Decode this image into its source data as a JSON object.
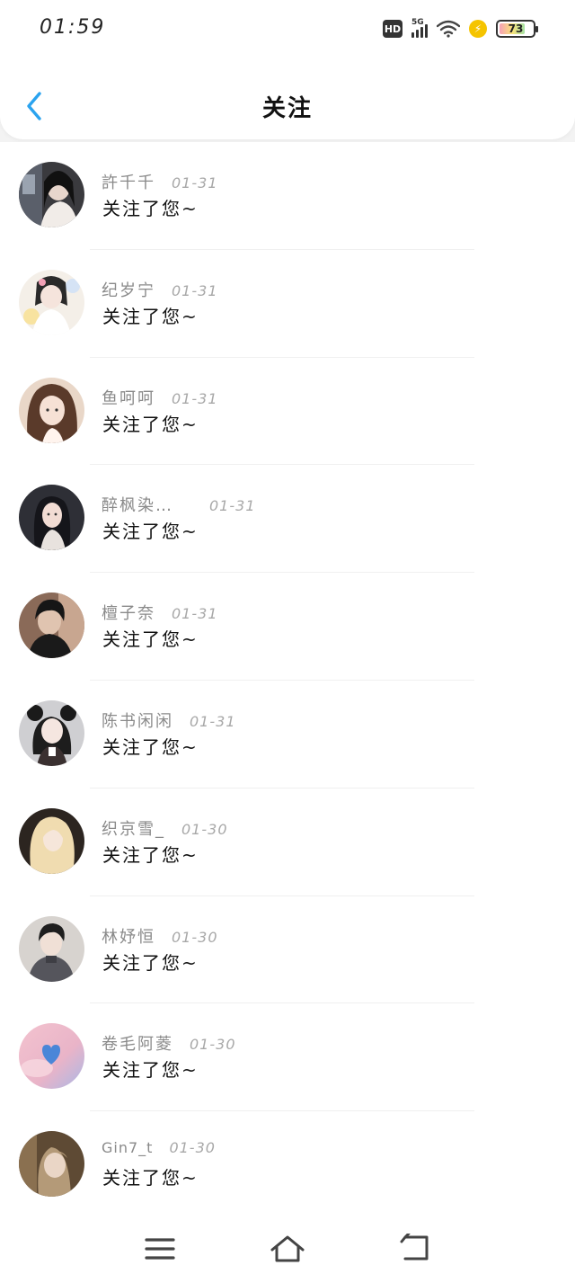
{
  "status_bar": {
    "time": "01:59",
    "hd": "HD",
    "network": "5G",
    "battery": "73"
  },
  "header": {
    "title": "关注",
    "back_icon": "chevron-left-icon",
    "accent": "#2aa3ef"
  },
  "notifications": [
    {
      "name": "許千千",
      "date": "01-31",
      "message": "关注了您~"
    },
    {
      "name": "纪岁宁",
      "date": "01-31",
      "message": "关注了您~"
    },
    {
      "name": "鱼呵呵",
      "date": "01-31",
      "message": "关注了您~"
    },
    {
      "name": "醉枫染…",
      "date": "01-31",
      "message": "关注了您~"
    },
    {
      "name": "檀子奈",
      "date": "01-31",
      "message": "关注了您~"
    },
    {
      "name": "陈书闲闲",
      "date": "01-31",
      "message": "关注了您~"
    },
    {
      "name": "织京雪_",
      "date": "01-30",
      "message": "关注了您~"
    },
    {
      "name": "林妤恒",
      "date": "01-30",
      "message": "关注了您~"
    },
    {
      "name": "卷毛阿菱",
      "date": "01-30",
      "message": "关注了您~"
    },
    {
      "name": "Gin7_t",
      "date": "01-30",
      "message": "关注了您~"
    }
  ],
  "bottom_nav": {
    "menu_icon": "menu-icon",
    "home_icon": "home-icon",
    "back_icon": "return-icon"
  }
}
